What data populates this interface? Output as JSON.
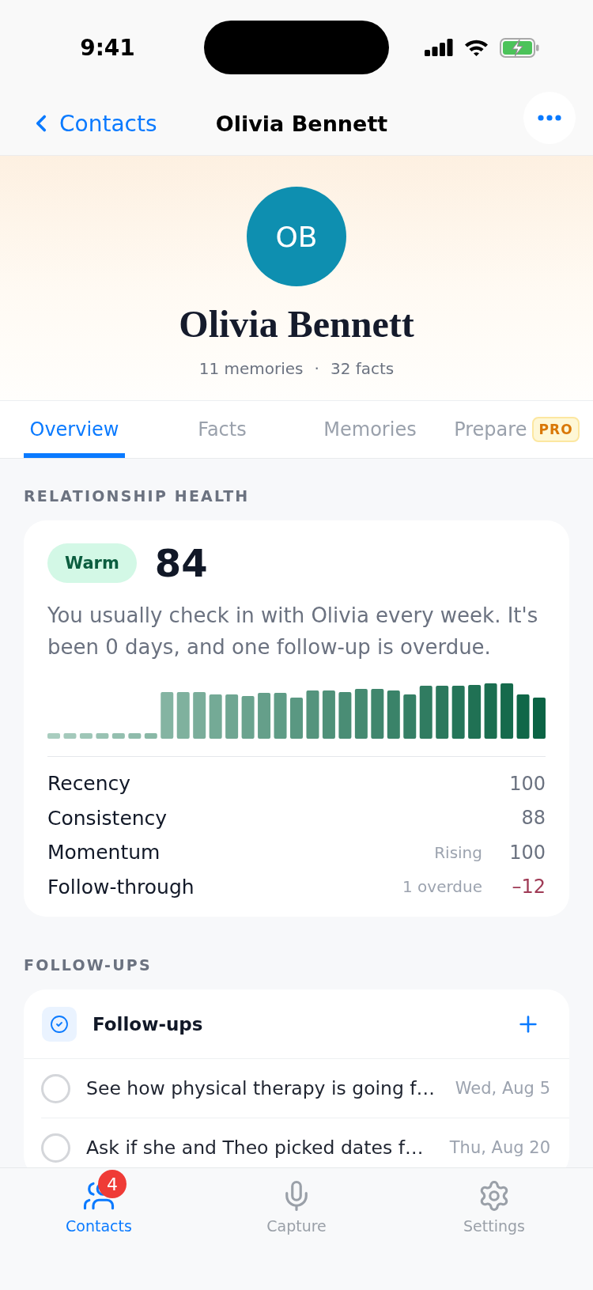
{
  "status_bar": {
    "time": "9:41"
  },
  "nav": {
    "back_label": "Contacts",
    "title": "Olivia Bennett"
  },
  "profile": {
    "initials": "OB",
    "name": "Olivia Bennett",
    "stats": [
      "11 memories",
      "32 facts"
    ],
    "separator": "·"
  },
  "tabs": [
    {
      "label": "Overview",
      "selected": true
    },
    {
      "label": "Facts",
      "selected": false
    },
    {
      "label": "Memories",
      "selected": false
    },
    {
      "label": "Prepare",
      "selected": false,
      "badge": "PRO"
    }
  ],
  "health": {
    "section_label": "RELATIONSHIP HEALTH",
    "status": "Warm",
    "score": "84",
    "summary": "You usually check in with Olivia every week. It's been 0 days, and one follow-up is overdue.",
    "metrics": [
      {
        "name": "Recency",
        "value": "100",
        "negative": false
      },
      {
        "name": "Consistency",
        "value": "88",
        "negative": false
      },
      {
        "name": "Momentum",
        "note": "Rising",
        "value": "100",
        "negative": false
      },
      {
        "name": "Follow-through",
        "note": "1 overdue",
        "value": "–12",
        "negative": true
      }
    ]
  },
  "follow_ups": {
    "section_label": "FOLLOW-UPS",
    "title": "Follow-ups",
    "items": [
      {
        "text": "See how physical therapy is going f…",
        "date": "Wed, Aug 5",
        "checked": false
      },
      {
        "text": "Ask if she and Theo picked dates f…",
        "date": "Thu, Aug 20",
        "checked": false
      }
    ]
  },
  "tab_bar": [
    {
      "label": "Contacts",
      "selected": true,
      "badge": "4"
    },
    {
      "label": "Capture",
      "selected": false
    },
    {
      "label": "Settings",
      "selected": false
    }
  ]
}
